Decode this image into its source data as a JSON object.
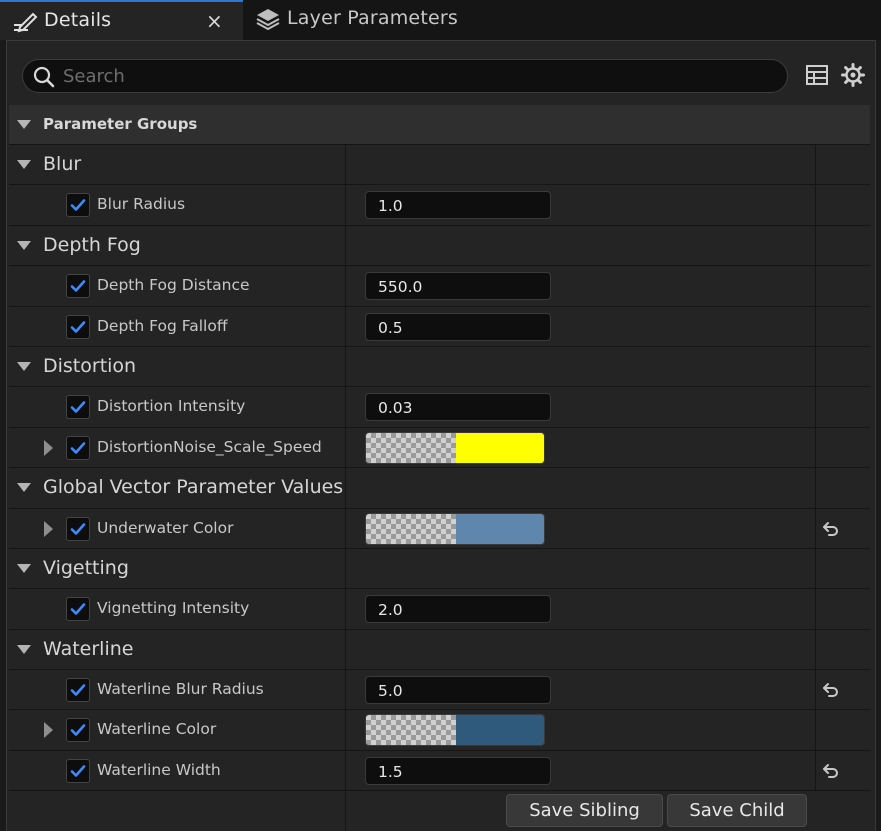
{
  "tabs": [
    {
      "label": "Details",
      "icon": "edit-pencil-icon",
      "active": true,
      "close": "×"
    },
    {
      "label": "Layer Parameters",
      "icon": "layers-icon",
      "active": false
    }
  ],
  "search": {
    "placeholder": "Search",
    "value": ""
  },
  "toolbar": {
    "table_icon": "table-view-icon",
    "settings_icon": "gear-icon"
  },
  "groups_header": "Parameter Groups",
  "categories": [
    {
      "label": "Blur",
      "params": [
        {
          "label": "Blur Radius",
          "type": "number",
          "value": "1.0",
          "checked": true,
          "expandable": false,
          "reset": false
        }
      ]
    },
    {
      "label": "Depth Fog",
      "params": [
        {
          "label": "Depth Fog Distance",
          "type": "number",
          "value": "550.0",
          "checked": true,
          "expandable": false,
          "reset": false
        },
        {
          "label": "Depth Fog Falloff",
          "type": "number",
          "value": "0.5",
          "checked": true,
          "expandable": false,
          "reset": false
        }
      ]
    },
    {
      "label": "Distortion",
      "params": [
        {
          "label": "Distortion Intensity",
          "type": "number",
          "value": "0.03",
          "checked": true,
          "expandable": false,
          "reset": false
        },
        {
          "label": "DistortionNoise_Scale_Speed",
          "type": "color",
          "color": "#ffff00",
          "checked": true,
          "expandable": true,
          "reset": false
        }
      ]
    },
    {
      "label": "Global Vector Parameter Values",
      "params": [
        {
          "label": "Underwater Color",
          "type": "color",
          "color": "#5f87ad",
          "checked": true,
          "expandable": true,
          "reset": true
        }
      ]
    },
    {
      "label": "Vigetting",
      "params": [
        {
          "label": "Vignetting Intensity",
          "type": "number",
          "value": "2.0",
          "checked": true,
          "expandable": false,
          "reset": false
        }
      ]
    },
    {
      "label": "Waterline",
      "params": [
        {
          "label": "Waterline Blur Radius",
          "type": "number",
          "value": "5.0",
          "checked": true,
          "expandable": false,
          "reset": true
        },
        {
          "label": "Waterline Color",
          "type": "color",
          "color": "#2f5a7b",
          "checked": true,
          "expandable": true,
          "reset": false
        },
        {
          "label": "Waterline Width",
          "type": "number",
          "value": "1.5",
          "checked": true,
          "expandable": false,
          "reset": true
        }
      ]
    }
  ],
  "footer": {
    "save_sibling": "Save Sibling",
    "save_child": "Save Child"
  },
  "colors": {
    "accent": "#2b78d6",
    "checkmark": "#3d8bff",
    "panel": "#242424",
    "field": "#0e0e0e"
  }
}
